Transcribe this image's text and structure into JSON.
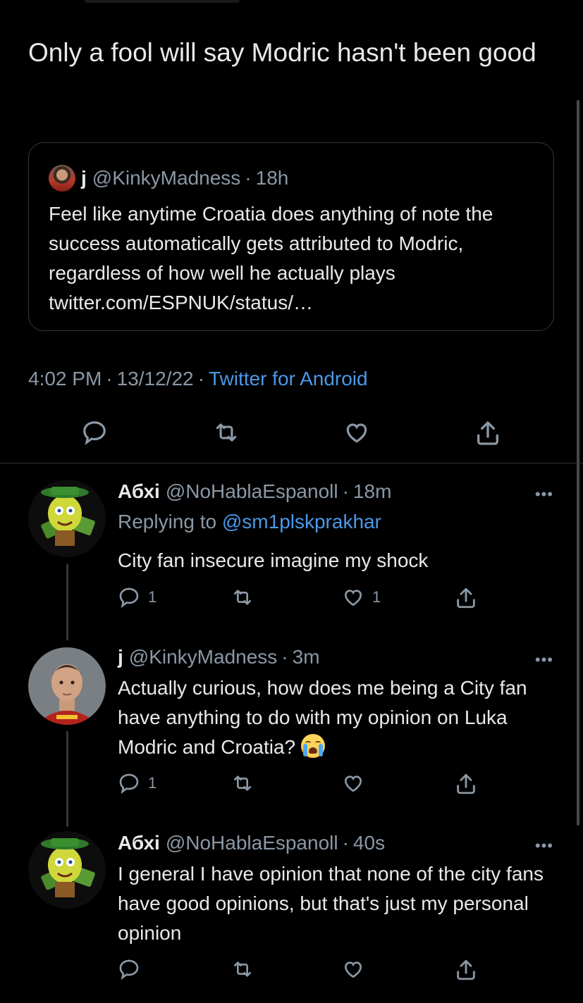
{
  "tweet": {
    "text": "Only a fool will say Modric hasn't been good",
    "time": "4:02 PM",
    "date": "13/12/22",
    "source": "Twitter for Android"
  },
  "quote": {
    "name": "j",
    "handle": "@KinkyMadness",
    "age": "18h",
    "text": "Feel like anytime Croatia does anything of note the success automatically gets attributed to Modric, regardless of how well he actually plays twitter.com/ESPNUK/status/…"
  },
  "replies": [
    {
      "name": "Абхі",
      "handle": "@NoHablaEspanoll",
      "age": "18m",
      "replying_prefix": "Replying to",
      "replying_to": "@sm1plskprakhar",
      "text": "City fan insecure imagine my shock",
      "reply_count": "1",
      "like_count": "1"
    },
    {
      "name": "j",
      "handle": "@KinkyMadness",
      "age": "3m",
      "text": "Actually curious, how does me being a City fan have anything to do with my opinion on Luka Modric and Croatia?",
      "emoji": "loudly-crying-face",
      "reply_count": "1"
    },
    {
      "name": "Абхі",
      "handle": "@NoHablaEspanoll",
      "age": "40s",
      "text": "I general I have opinion that none of the city fans have good opinions, but that's just my personal opinion"
    }
  ],
  "ui": {
    "dot": "·",
    "more": "•••"
  },
  "colors": {
    "background": "#000000",
    "text": "#e7e9ea",
    "muted": "#8b98a5",
    "link": "#4a99e9"
  },
  "icons": [
    "reply-icon",
    "retweet-icon",
    "like-icon",
    "share-icon",
    "more-icon"
  ]
}
